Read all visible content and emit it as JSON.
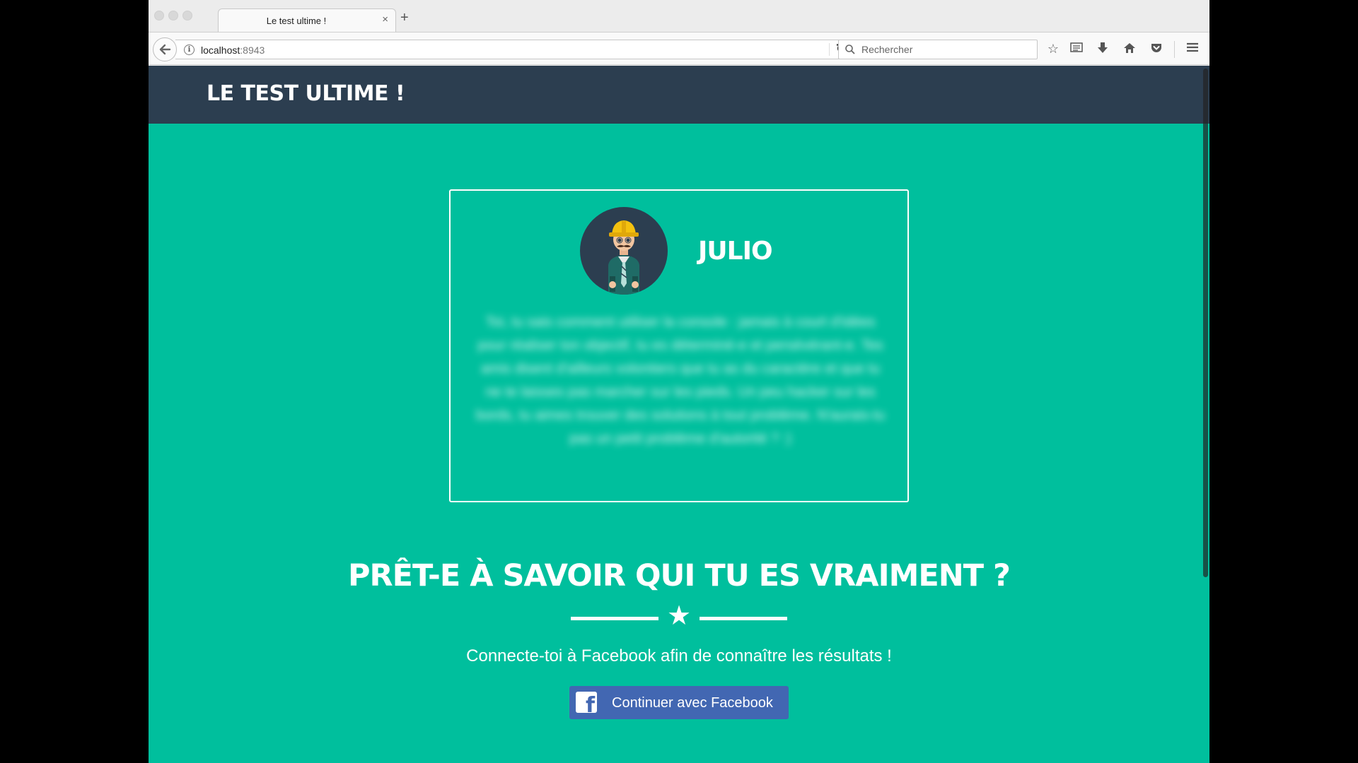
{
  "browser": {
    "tab_title": "Le test ultime !",
    "tab_close": "×",
    "new_tab": "+",
    "url_host": "localhost",
    "url_port": ":8943",
    "search_placeholder": "Rechercher"
  },
  "site": {
    "header_title": "LE TEST ULTIME !"
  },
  "profile": {
    "name": "JULIO",
    "description": "Toi, tu sais comment utiliser la console : jamais à court d'idées pour réaliser ton objectif, tu es déterminé-e et persévérant-e. Tes amis disent d'ailleurs volontiers que tu as du caractère et que tu ne te laisses pas marcher sur les pieds. Un peu hacker sur les bords, tu aimes trouver des solutions à tout problème. N'aurais-tu pas un petit problème d'autorité ? :)"
  },
  "cta": {
    "title": "PRÊT-E À SAVOIR QUI TU ES VRAIMENT ?",
    "subtitle": "Connecte-toi à Facebook afin de connaître les résultats !",
    "facebook_button_label": "Continuer avec Facebook"
  },
  "colors": {
    "page_background": "#00bf9d",
    "header_background": "#2c3e50",
    "facebook_blue": "#4267b2"
  }
}
